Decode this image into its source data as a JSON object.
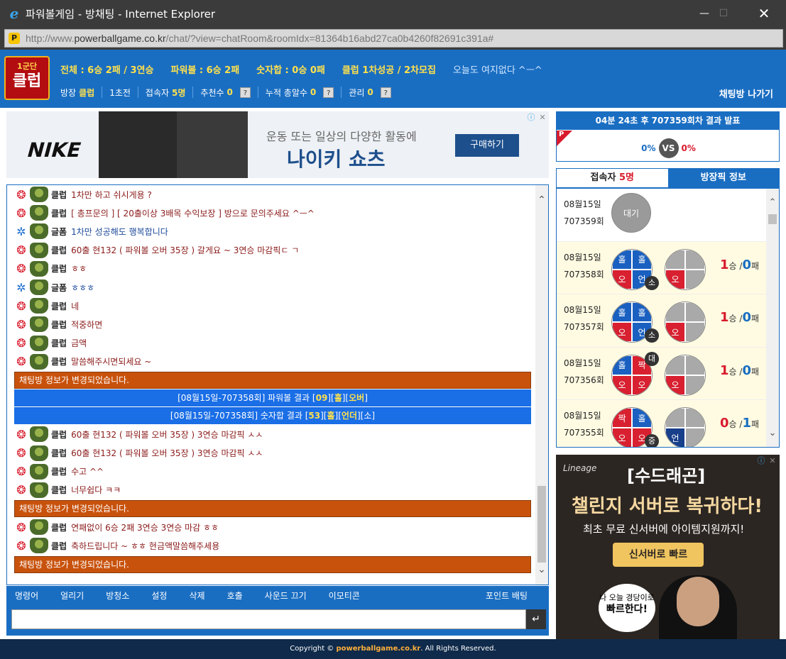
{
  "window": {
    "title": "파워볼게임 - 방채팅 - Internet Explorer",
    "url_prefix": "http://www.",
    "url_domain": "powerballgame.co.kr",
    "url_path": "/chat/?view=chatRoom&roomIdx=81364b16abd27ca0b4260f82691c391a#"
  },
  "header": {
    "logo_top": "1군단",
    "logo_main": "클럽",
    "stats": {
      "total": "전체 : 6승 2패 / 3연승",
      "powerball": "파워볼 : 6승 2패",
      "numsum": "숫자합 : 0승 0패",
      "club": "클럽 1차성공 / 2차모집",
      "quote": "오늘도 여지없다 ^ㅡ^"
    },
    "info": {
      "room_label": "방장",
      "room_value": "클럽",
      "level": "1초전",
      "users_label": "접속자",
      "users_value": "5명",
      "recommend_label": "추천수",
      "recommend_value": "0",
      "cumulative_label": "누적 총알수",
      "cumulative_value": "0",
      "manage_label": "관리",
      "manage_value": "0",
      "help": "?"
    },
    "exit_label": "채팅방 나가기"
  },
  "ad_top": {
    "brand": "NIKE",
    "sub": "운동 또는 일상의 다양한 활동에",
    "main": "나이키 쇼츠",
    "button": "구매하기"
  },
  "chat": {
    "messages": [
      {
        "type": "msg",
        "level": "red",
        "nick": "클럽",
        "text": "1차만 하고 쉬시게용 ?",
        "color": "red"
      },
      {
        "type": "msg",
        "level": "red",
        "nick": "클럽",
        "text": "[ 총프문의 ] [ 20출이상 3배목 수익보장 ] 방으로 문의주세요 ^ㅡ^",
        "color": "red"
      },
      {
        "type": "msg",
        "level": "blue",
        "nick": "글폼",
        "text": "1차만 성공해도 행복합니다",
        "color": "blue"
      },
      {
        "type": "msg",
        "level": "red",
        "nick": "클럽",
        "text": "60출 현132 ( 파워볼 오버 35장 ) 갈게요 ~ 3연승 마감픽ㄷ ㄱ",
        "color": "red"
      },
      {
        "type": "msg",
        "level": "red",
        "nick": "클럽",
        "text": "ㅎㅎ",
        "color": "red"
      },
      {
        "type": "msg",
        "level": "blue",
        "nick": "글폼",
        "text": "ㅎㅎㅎ",
        "color": "blue"
      },
      {
        "type": "msg",
        "level": "red",
        "nick": "클럽",
        "text": "네",
        "color": "red"
      },
      {
        "type": "msg",
        "level": "red",
        "nick": "클럽",
        "text": "적중하면",
        "color": "red"
      },
      {
        "type": "msg",
        "level": "red",
        "nick": "클럽",
        "text": "금액",
        "color": "red"
      },
      {
        "type": "msg",
        "level": "red",
        "nick": "클럽",
        "text": "말씀해주시면되세요 ~",
        "color": "red"
      },
      {
        "type": "sys",
        "text": "채팅방 정보가 변경되었습니다."
      },
      {
        "type": "res",
        "pre": "[08월15일-707358회] 파워볼 결과 [",
        "v1": "09",
        "mid": "][",
        "v2": "홀",
        "mid2": "][",
        "v3": "오버",
        "post": "]"
      },
      {
        "type": "res",
        "pre": "[08월15일-707358회] 숫자합 결과 [",
        "v1": "53",
        "mid": "][",
        "v2": "홀",
        "mid2": "][",
        "v3": "언더",
        "post": "][소]"
      },
      {
        "type": "msg",
        "level": "red",
        "nick": "클럽",
        "text": "60출 현132 ( 파워볼 오버 35장 ) 3연승 마감픽 ㅅㅅ",
        "color": "red"
      },
      {
        "type": "msg",
        "level": "red",
        "nick": "클럽",
        "text": "60출 현132 ( 파워볼 오버 35장 ) 3연승 마감픽 ㅅㅅ",
        "color": "red"
      },
      {
        "type": "msg",
        "level": "red",
        "nick": "클럽",
        "text": "수고 ^^",
        "color": "red"
      },
      {
        "type": "msg",
        "level": "red",
        "nick": "클럽",
        "text": "너무쉽다 ㅋㅋ",
        "color": "red"
      },
      {
        "type": "sys",
        "text": "채팅방 정보가 변경되었습니다."
      },
      {
        "type": "msg",
        "level": "red",
        "nick": "클럽",
        "text": "연패없이 6승 2패 3연승 3연승 마감 ㅎㅎ",
        "color": "red"
      },
      {
        "type": "msg",
        "level": "red",
        "nick": "클럽",
        "text": "축하드립니다 ~ ㅎㅎ 현금액말씀해주세용",
        "color": "red"
      },
      {
        "type": "sys",
        "text": "채팅방 정보가 변경되었습니다."
      }
    ]
  },
  "menu": {
    "items": [
      "명령어",
      "얼리기",
      "방청소",
      "설정",
      "삭제",
      "호출",
      "사운드 끄기",
      "이모티콘"
    ],
    "point": "포인트 배팅"
  },
  "input": {
    "placeholder": "",
    "send": "↵"
  },
  "result_panel": {
    "head": "04분 24초 후 707359회차 결과 발표",
    "flag": "P",
    "left_pct": "0%",
    "vs": "VS",
    "right_pct": "0%"
  },
  "tabs": {
    "users_label": "접속자",
    "users_count": "5명",
    "info": "방장픽 정보"
  },
  "picks": [
    {
      "date": "08월15일",
      "round": "707359회",
      "wait": "대기"
    },
    {
      "date": "08월15일",
      "round": "707358회",
      "b1": [
        "홀",
        "홀",
        "오",
        "언"
      ],
      "tag": "소",
      "b2_q4": "오",
      "win": "1",
      "lose": "0",
      "sep": "승 /",
      "unit": "패"
    },
    {
      "date": "08월15일",
      "round": "707357회",
      "b1": [
        "홀",
        "홀",
        "오",
        "언"
      ],
      "tag": "소",
      "b2_q4": "오",
      "win": "1",
      "lose": "0",
      "sep": "승 /",
      "unit": "패"
    },
    {
      "date": "08월15일",
      "round": "707356회",
      "b1": [
        "홀",
        "짝",
        "오",
        "오"
      ],
      "tag": "대",
      "b2_q4": "오",
      "win": "1",
      "lose": "0",
      "sep": "승 /",
      "unit": "패"
    },
    {
      "date": "08월15일",
      "round": "707355회",
      "b1": [
        "짝",
        "홀",
        "오",
        "오"
      ],
      "tag": "중",
      "b2_q4": "언",
      "win": "0",
      "lose": "1",
      "sep": "승 /",
      "unit": "패"
    }
  ],
  "ad_right": {
    "brand": "Lineage",
    "title": "[수드래곤]",
    "main": "챌린지 서버로 복귀하다!",
    "sub": "최초 무료 신서버에 아이템지원까지!",
    "button": "신서버로 빠르",
    "bubble1": "나 오늘 경당이로",
    "bubble2": "빠르한다!"
  },
  "footer": {
    "pre": "Copyright ©",
    "domain": "powerballgame.co.kr",
    "post": ". All Rights Reserved."
  }
}
